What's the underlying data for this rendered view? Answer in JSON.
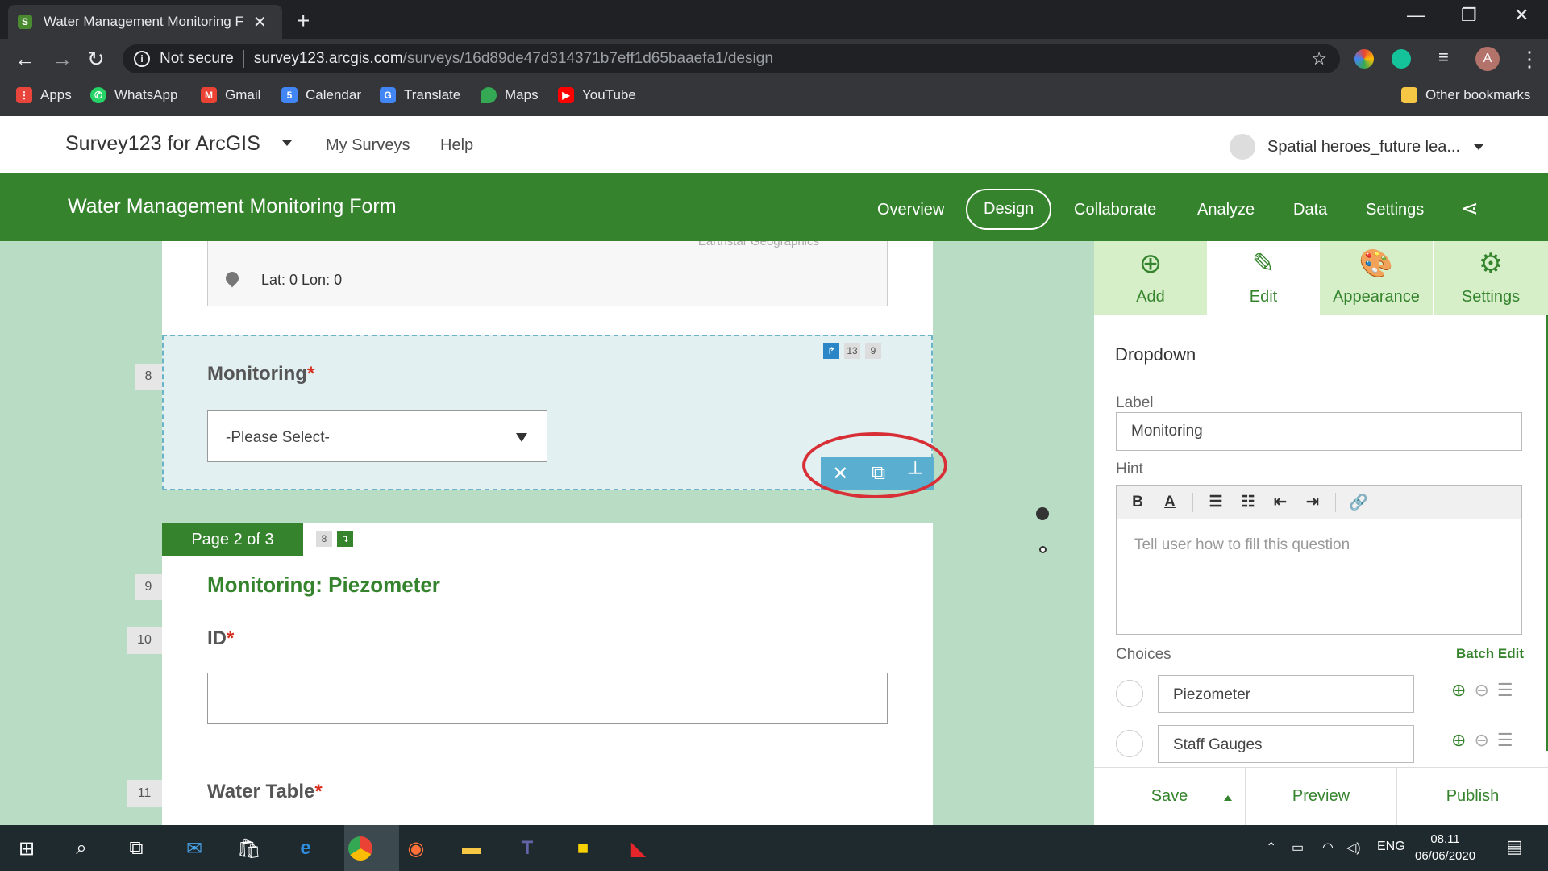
{
  "browser": {
    "tab_title": "Water Management Monitoring F",
    "tab_close": "✕",
    "new_tab": "+",
    "security_label": "Not secure",
    "url_host": "survey123.arcgis.com",
    "url_path": "/surveys/16d89de47d314371b7eff1d65baaefa1/design",
    "profile_initial": "A",
    "window_controls": [
      "—",
      "❐",
      "✕"
    ],
    "bookmarks": [
      "Apps",
      "WhatsApp",
      "Gmail",
      "Calendar",
      "Translate",
      "Maps",
      "YouTube"
    ],
    "other_bookmarks": "Other bookmarks"
  },
  "app": {
    "brand": "Survey123 for ArcGIS",
    "nav": [
      "My Surveys",
      "Help"
    ],
    "user": "Spatial heroes_future lea..."
  },
  "form_bar": {
    "title": "Water Management Monitoring Form",
    "tabs": [
      "Overview",
      "Design",
      "Collaborate",
      "Analyze",
      "Data",
      "Settings"
    ],
    "active_tab": "Design"
  },
  "canvas": {
    "map_attribution": "Earthstar Geographics",
    "latlon": "Lat: 0 Lon: 0",
    "q8": {
      "num": "8",
      "label": "Monitoring",
      "req": "*",
      "placeholder": "-Please Select-",
      "badges": [
        "13",
        "9"
      ]
    },
    "page_tag": "Page 2 of 3",
    "page_badge": "8",
    "q9": {
      "num": "9",
      "label": "Monitoring: Piezometer"
    },
    "q10": {
      "num": "10",
      "label": "ID",
      "req": "*"
    },
    "q11": {
      "num": "11",
      "label": "Water Table",
      "req": "*"
    }
  },
  "panel": {
    "tabs": [
      "Add",
      "Edit",
      "Appearance",
      "Settings"
    ],
    "active_tab": "Edit",
    "title": "Dropdown",
    "label_caption": "Label",
    "label_value": "Monitoring",
    "hint_caption": "Hint",
    "hint_placeholder": "Tell user how to fill this question",
    "choices_caption": "Choices",
    "batch_edit": "Batch Edit",
    "choices": [
      "Piezometer",
      "Staff Gauges"
    ],
    "footer": [
      "Save",
      "Preview",
      "Publish"
    ]
  },
  "taskbar": {
    "language": "ENG",
    "time": "08.11",
    "date": "06/06/2020"
  },
  "colors": {
    "brand_green": "#35842d",
    "selection_blue": "#5aaed0",
    "annotation_red": "#d72f35",
    "canvas_bg": "#b8dcc4"
  }
}
